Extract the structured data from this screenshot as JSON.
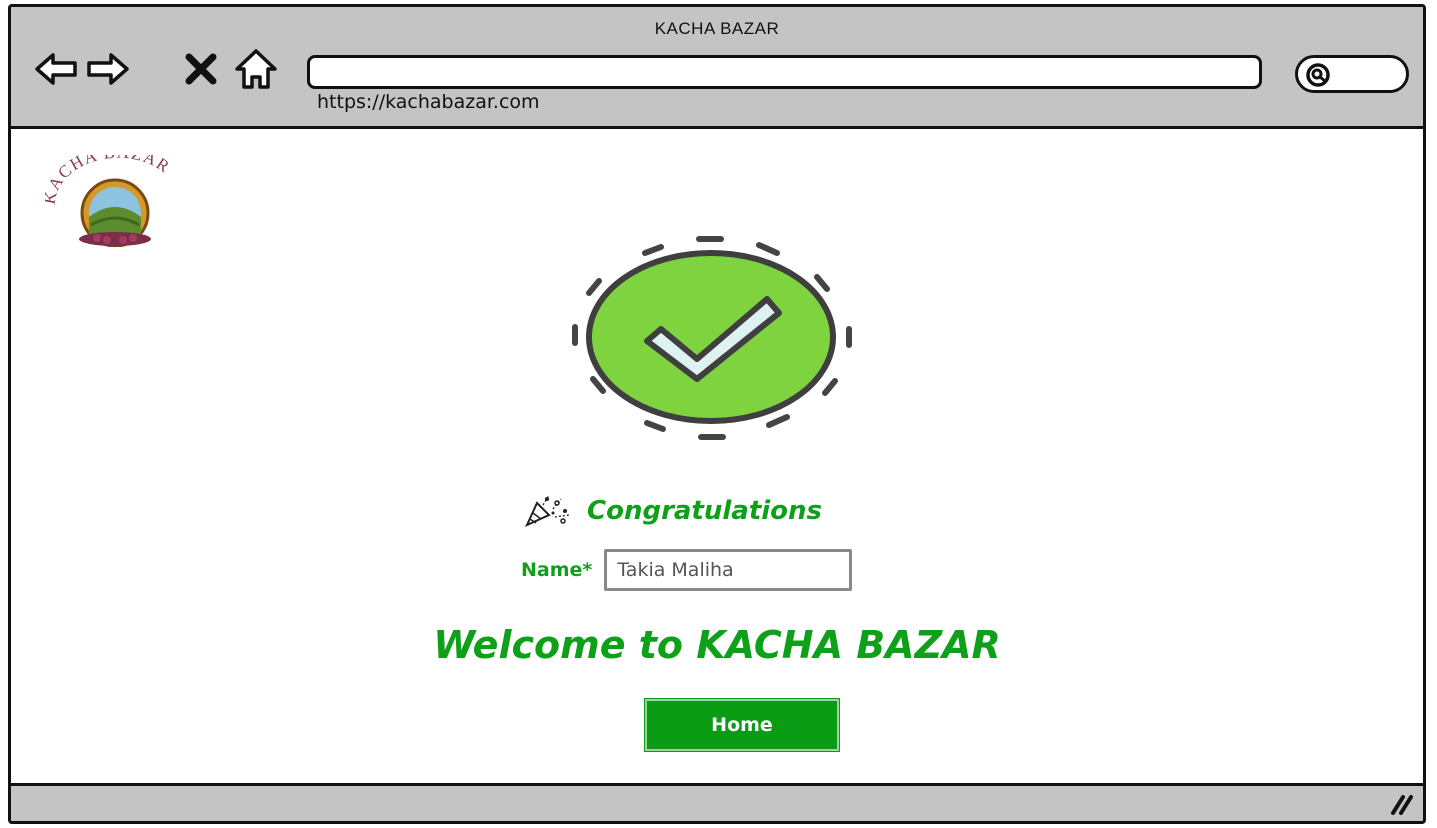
{
  "window": {
    "title": "KACHA BAZAR"
  },
  "address_bar": {
    "url": "https://kachabazar.com"
  },
  "logo": {
    "text": "KACHA BAZAR"
  },
  "main": {
    "congrats_text": "Congratulations",
    "name_label": "Name*",
    "name_value": "Takia Maliha",
    "welcome_text": "Welcome to KACHA BAZAR",
    "home_button": "Home"
  },
  "colors": {
    "chrome_bg": "#c4c4c4",
    "accent_green": "#0ea019",
    "badge_green": "#7ed33f",
    "button_green": "#0b9c15"
  },
  "icons": {
    "back": "arrow-left-icon",
    "forward": "arrow-right-icon",
    "stop": "close-icon",
    "home": "home-icon",
    "search": "search-icon",
    "success": "check-circle-icon",
    "party": "party-popper-icon",
    "resize": "resize-grip-icon"
  }
}
